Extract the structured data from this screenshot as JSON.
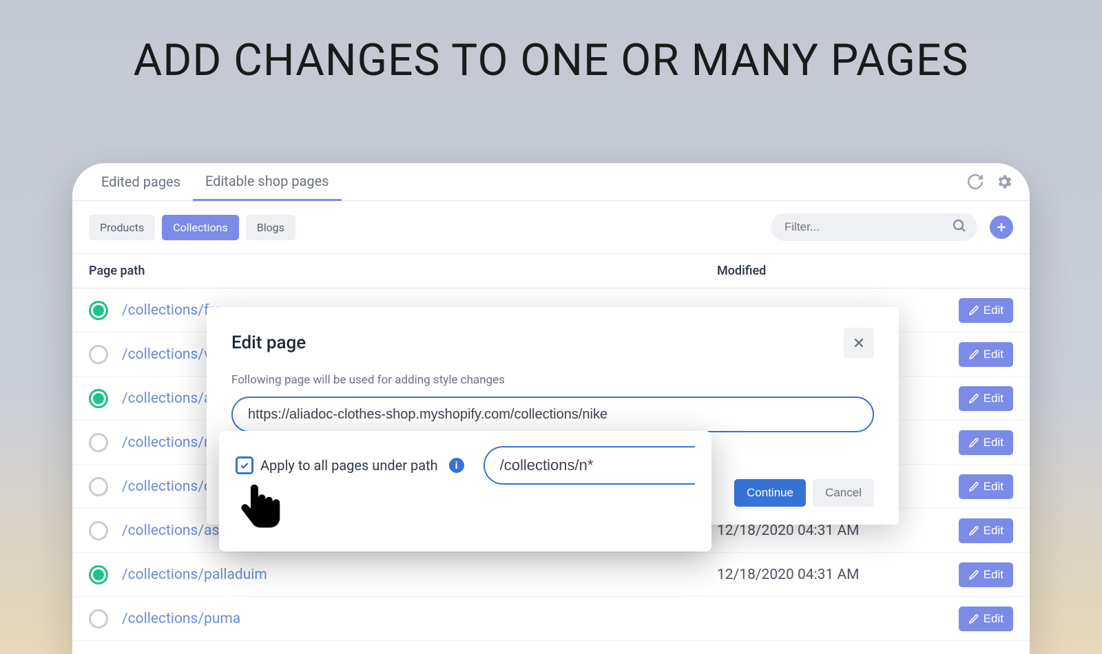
{
  "headline": "ADD CHANGES TO ONE OR MANY PAGES",
  "tabs": {
    "edited": "Edited pages",
    "editable": "Editable shop pages"
  },
  "chips": {
    "products": "Products",
    "collections": "Collections",
    "blogs": "Blogs"
  },
  "filter": {
    "placeholder": "Filter..."
  },
  "table": {
    "head_path": "Page path",
    "head_modified": "Modified",
    "edit_label": "Edit",
    "rows": [
      {
        "path": "/collections/fre",
        "active": true
      },
      {
        "path": "/collections/va",
        "active": false
      },
      {
        "path": "/collections/ad",
        "active": true
      },
      {
        "path": "/collections/ni",
        "active": false
      },
      {
        "path": "/collections/co",
        "active": false
      },
      {
        "path": "/collections/asics-tiger",
        "active": false,
        "mod": "12/18/2020 04:31 AM"
      },
      {
        "path": "/collections/palladuim",
        "active": true,
        "mod": "12/18/2020 04:31 AM"
      },
      {
        "path": "/collections/puma",
        "active": false
      }
    ]
  },
  "modal": {
    "title": "Edit page",
    "subtext": "Following page will be used for adding style changes",
    "url": "https://aliadoc-clothes-shop.myshopify.com/collections/nike",
    "continue": "Continue",
    "cancel": "Cancel"
  },
  "callout": {
    "label": "Apply to all pages under path",
    "pattern": "/collections/n*"
  }
}
